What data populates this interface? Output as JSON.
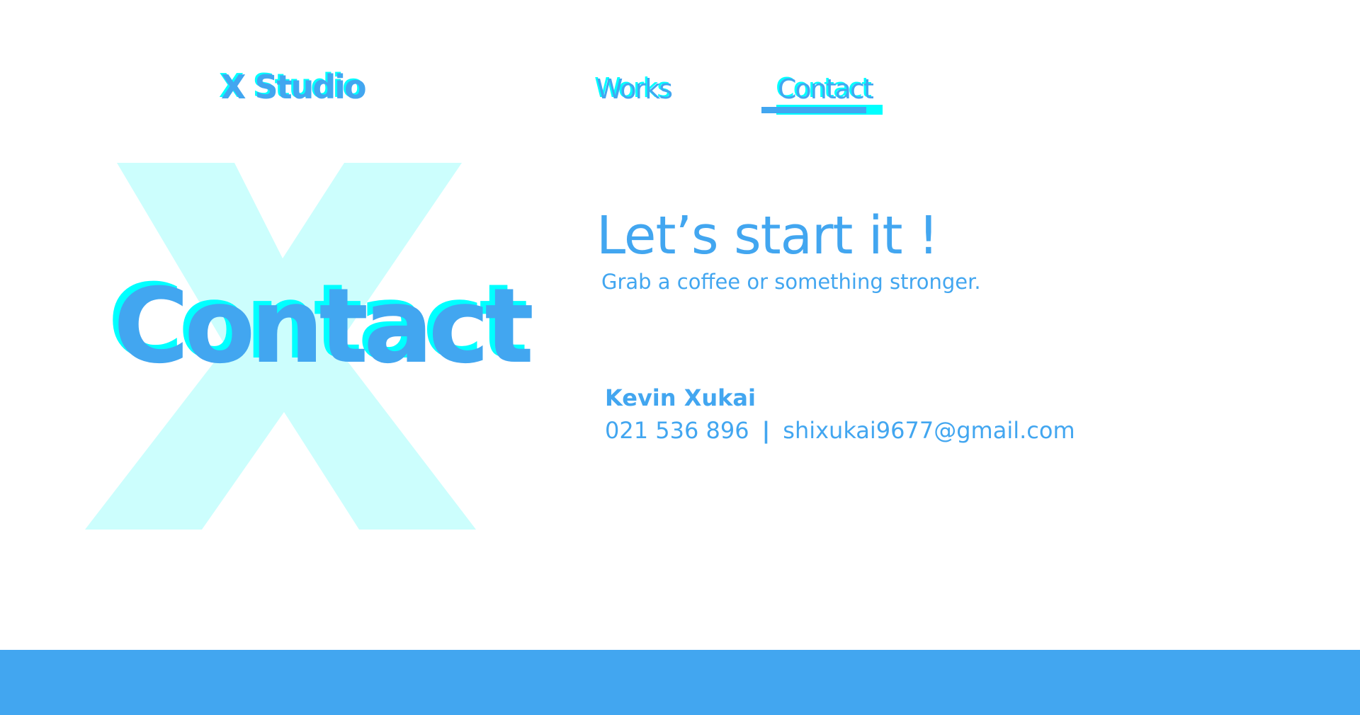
{
  "colors": {
    "accent": "#42a6f0",
    "accent_shadow": "#00ffff",
    "watermark": "#ccfefd",
    "background": "#ffffff"
  },
  "header": {
    "logo": "X Studio",
    "nav": [
      {
        "label": "Works",
        "active": false
      },
      {
        "label": "Contact",
        "active": true
      }
    ]
  },
  "hero": {
    "watermark_letter": "X",
    "title": "Contact"
  },
  "main": {
    "headline": "Let’s start it !",
    "subline": "Grab a coffee or something stronger.",
    "contact": {
      "name": "Kevin Xukai",
      "phone": "021 536 896",
      "separator": "|",
      "email": "shixukai9677@gmail.com"
    }
  }
}
